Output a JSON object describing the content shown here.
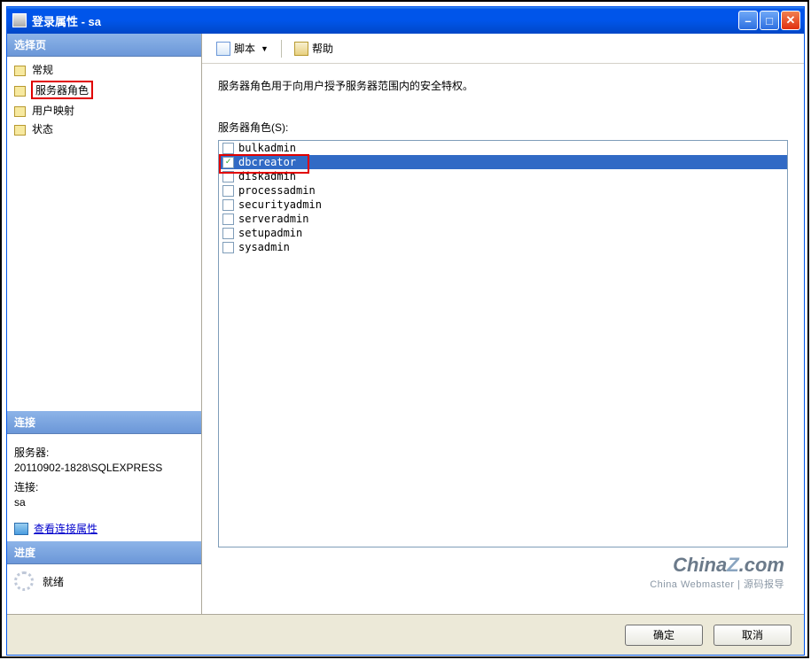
{
  "window": {
    "title": "登录属性 - sa"
  },
  "sidebar": {
    "select_page_header": "选择页",
    "nav": [
      {
        "label": "常规",
        "highlighted": false
      },
      {
        "label": "服务器角色",
        "highlighted": true
      },
      {
        "label": "用户映射",
        "highlighted": false
      },
      {
        "label": "状态",
        "highlighted": false
      }
    ],
    "connection_header": "连接",
    "server_label": "服务器:",
    "server_value": "20110902-1828\\SQLEXPRESS",
    "conn_label": "连接:",
    "conn_value": "sa",
    "view_conn_props": "查看连接属性",
    "progress_header": "进度",
    "ready": "就绪"
  },
  "toolbar": {
    "script_label": "脚本",
    "help_label": "帮助"
  },
  "main": {
    "description": "服务器角色用于向用户授予服务器范围内的安全特权。",
    "roles_label": "服务器角色(S):",
    "roles": [
      {
        "name": "bulkadmin",
        "checked": false,
        "selected": false,
        "red": false
      },
      {
        "name": "dbcreator",
        "checked": true,
        "selected": true,
        "red": true
      },
      {
        "name": "diskadmin",
        "checked": false,
        "selected": false,
        "red": false
      },
      {
        "name": "processadmin",
        "checked": false,
        "selected": false,
        "red": false
      },
      {
        "name": "securityadmin",
        "checked": false,
        "selected": false,
        "red": false
      },
      {
        "name": "serveradmin",
        "checked": false,
        "selected": false,
        "red": false
      },
      {
        "name": "setupadmin",
        "checked": false,
        "selected": false,
        "red": false
      },
      {
        "name": "sysadmin",
        "checked": false,
        "selected": false,
        "red": false
      }
    ]
  },
  "buttons": {
    "ok": "确定",
    "cancel": "取消"
  },
  "watermark": {
    "brand_a": "China",
    "brand_b": "Z",
    "brand_c": ".com",
    "tagline": "China Webmaster | 源码报导"
  }
}
